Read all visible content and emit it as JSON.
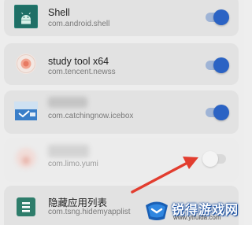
{
  "apps": [
    {
      "name": "Shell",
      "package": "com.android.shell",
      "enabled": true,
      "icon": "android-icon"
    },
    {
      "name": "study tool x64",
      "package": "com.tencent.newss",
      "enabled": true,
      "icon": "study-tool-icon"
    },
    {
      "name": "",
      "package": "com.catchingnow.icebox",
      "enabled": true,
      "icon": "icebox-icon"
    },
    {
      "name": "",
      "package": "com.limo.yumi",
      "enabled": false,
      "icon": "yumi-icon"
    },
    {
      "name": "隐藏应用列表",
      "package": "com.tsng.hidemyapplist",
      "enabled": true,
      "icon": "hidemyapplist-icon"
    }
  ],
  "watermark": {
    "text": "锐得游戏网",
    "url": "www.ytruida.com"
  },
  "colors": {
    "toggle_on": "#2b63c4",
    "toggle_track_on": "#9fb4d6",
    "annotation_arrow": "#e23d2f",
    "card_background": "#e2e2e2"
  }
}
